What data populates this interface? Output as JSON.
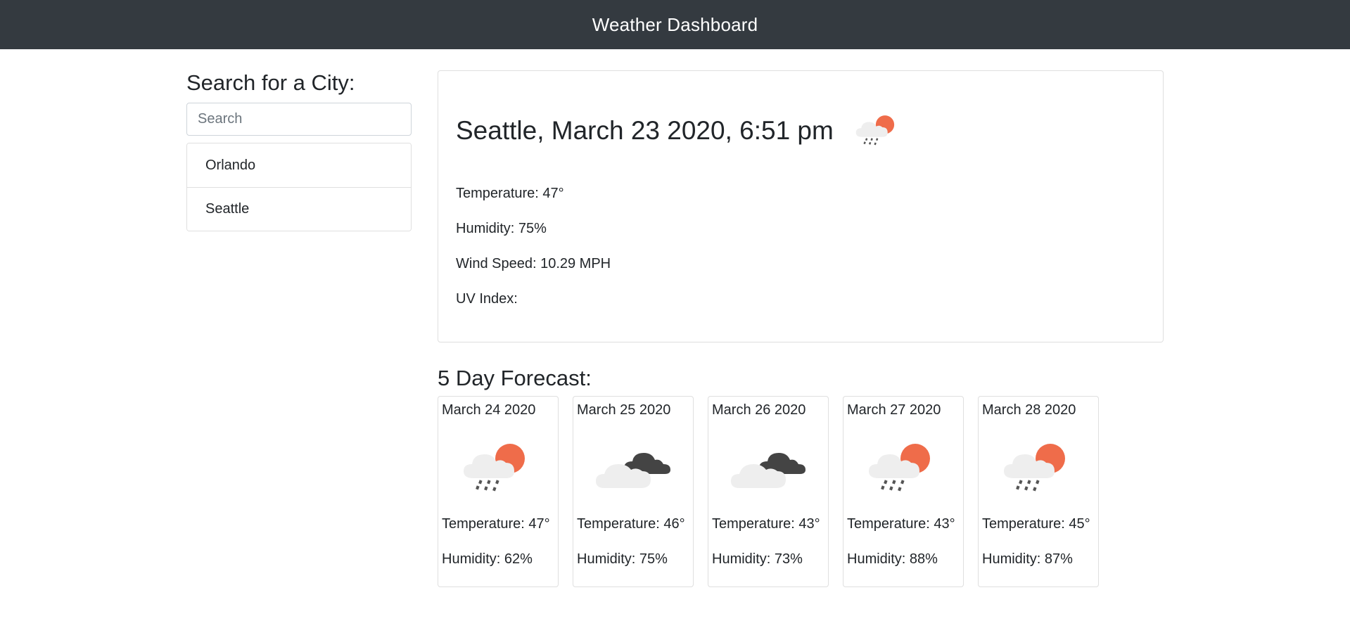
{
  "app": {
    "title": "Weather Dashboard"
  },
  "search": {
    "heading": "Search for a City:",
    "placeholder": "Search",
    "value": ""
  },
  "cities": [
    {
      "label": "Orlando"
    },
    {
      "label": "Seattle"
    }
  ],
  "current": {
    "title": "Seattle, March 23 2020, 6:51 pm",
    "icon": "rain-sun-icon",
    "temperature": "Temperature: 47°",
    "humidity": "Humidity: 75%",
    "wind": "Wind Speed: 10.29 MPH",
    "uv": "UV Index:"
  },
  "forecast": {
    "heading": "5 Day Forecast:",
    "days": [
      {
        "date": "March 24 2020",
        "icon": "rain-sun-icon",
        "temperature": "Temperature: 47°",
        "humidity": "Humidity: 62%"
      },
      {
        "date": "March 25 2020",
        "icon": "broken-clouds-icon",
        "temperature": "Temperature: 46°",
        "humidity": "Humidity: 75%"
      },
      {
        "date": "March 26 2020",
        "icon": "broken-clouds-icon",
        "temperature": "Temperature: 43°",
        "humidity": "Humidity: 73%"
      },
      {
        "date": "March 27 2020",
        "icon": "rain-sun-icon",
        "temperature": "Temperature: 43°",
        "humidity": "Humidity: 88%"
      },
      {
        "date": "March 28 2020",
        "icon": "rain-sun-icon",
        "temperature": "Temperature: 45°",
        "humidity": "Humidity: 87%"
      }
    ]
  },
  "colors": {
    "navbar": "#343a40",
    "sun": "#ef6c4a",
    "cloud_light": "#eeeeee",
    "cloud_dark": "#444444",
    "rain": "#555555"
  }
}
